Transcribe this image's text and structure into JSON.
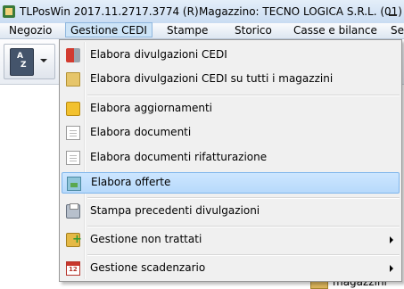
{
  "titlebar": {
    "title": "TLPosWin 2017.11.2717.3774 (R)",
    "warehouse": "Magazzino: TECNO LOGICA S.R.L. (01)"
  },
  "menubar": {
    "items": [
      {
        "label": "Negozio"
      },
      {
        "label": "Gestione CEDI",
        "active": true
      },
      {
        "label": "Stampe"
      },
      {
        "label": "Storico"
      },
      {
        "label": "Casse e bilance"
      },
      {
        "label": "Se"
      }
    ]
  },
  "toolbar": {
    "book_letters_top": "A",
    "book_letters_bottom": "Z"
  },
  "dropdown": {
    "items": [
      {
        "label": "Elabora divulgazioni CEDI",
        "icon": "truck-icon"
      },
      {
        "label": "Elabora divulgazioni CEDI su tutti i magazzini",
        "icon": "folder-icon"
      },
      {
        "label": "Elabora aggiornamenti",
        "icon": "box-icon"
      },
      {
        "label": "Elabora documenti",
        "icon": "document-icon"
      },
      {
        "label": "Elabora documenti rifatturazione",
        "icon": "document-icon"
      },
      {
        "label": "Elabora offerte",
        "icon": "offer-icon",
        "highlighted": true
      },
      {
        "label": "Stampa precedenti divulgazioni",
        "icon": "printer-icon"
      },
      {
        "label": "Gestione non trattati",
        "icon": "add-icon",
        "submenu": true
      },
      {
        "label": "Gestione scadenzario",
        "icon": "calendar-icon",
        "submenu": true
      }
    ]
  },
  "background": {
    "label": "magazzini"
  },
  "colors": {
    "highlight": "#cde6ff",
    "menu_bg": "#f0f0f0",
    "titlebar": "#c9dcf2"
  }
}
